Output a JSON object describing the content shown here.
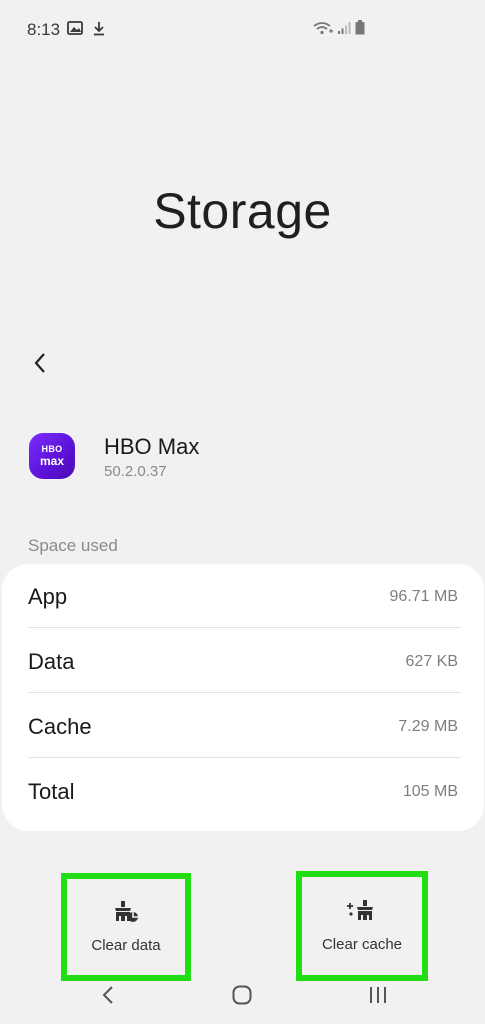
{
  "status_bar": {
    "time": "8:13",
    "icons": [
      "image-icon",
      "download-icon",
      "wifi-icon",
      "signal-icon",
      "battery-icon"
    ]
  },
  "header": {
    "title": "Storage"
  },
  "app": {
    "name": "HBO Max",
    "version": "50.2.0.37",
    "icon_text_top": "HBO",
    "icon_text_bottom": "max"
  },
  "space_used": {
    "label": "Space used",
    "rows": [
      {
        "key": "App",
        "value": "96.71 MB"
      },
      {
        "key": "Data",
        "value": "627 KB"
      },
      {
        "key": "Cache",
        "value": "7.29 MB"
      },
      {
        "key": "Total",
        "value": "105 MB"
      }
    ]
  },
  "actions": {
    "clear_data": "Clear data",
    "clear_cache": "Clear cache"
  },
  "colors": {
    "highlight": "#22dd11",
    "app_icon": "#6a1bf0",
    "background": "#f1f1f1"
  },
  "navigation": [
    "back-icon",
    "home-icon",
    "recents-icon"
  ]
}
